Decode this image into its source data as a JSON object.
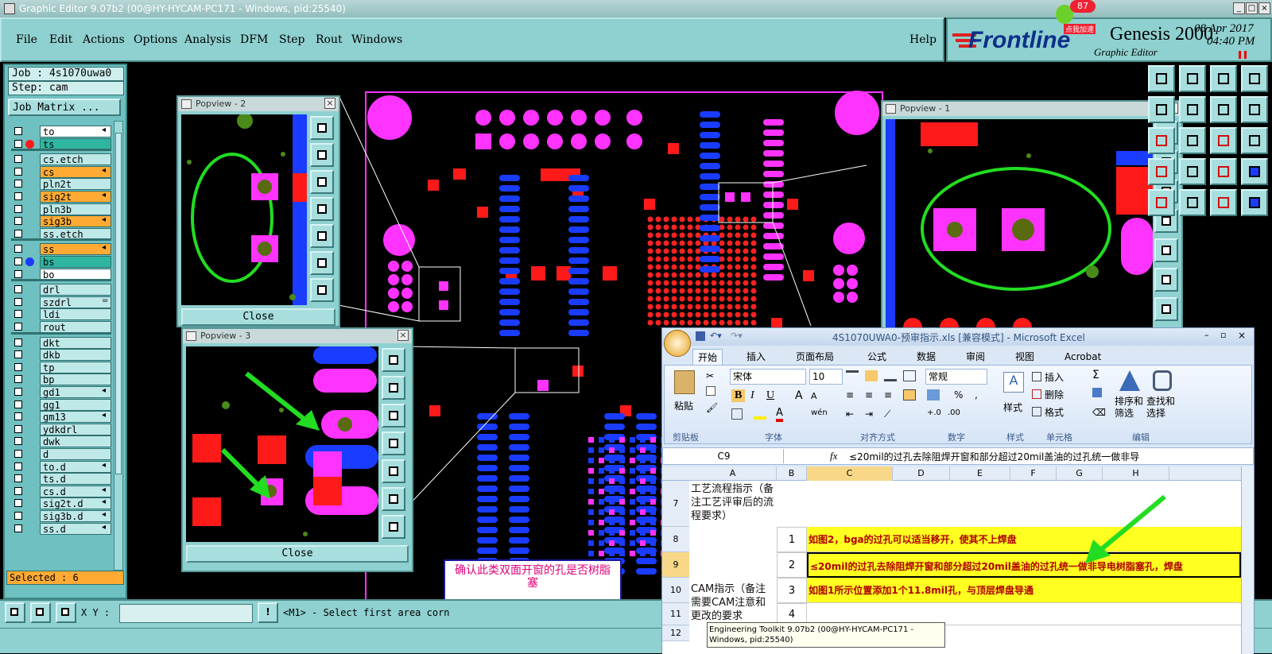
{
  "window": {
    "title": "Graphic Editor 9.07b2 (00@HY-HYCAM-PC171 - Windows, pid:25540)"
  },
  "menu": [
    "File",
    "Edit",
    "Actions",
    "Options",
    "Analysis",
    "DFM",
    "Step",
    "Rout",
    "Windows"
  ],
  "help": "Help",
  "brand": {
    "logo": "Frontline",
    "product": "Genesis 2000",
    "subtitle": "Graphic Editor",
    "date": "08 Apr 2017",
    "time": "04:40 PM",
    "badge": "87",
    "badge_caption": "点我加速"
  },
  "job": {
    "job_label": "Job : 4s1070uwa0",
    "step_label": "Step: cam",
    "matrix_button": "Job Matrix ..."
  },
  "layers": [
    {
      "name": "to",
      "color": "#ffffff",
      "dot": "",
      "arrow": "◂"
    },
    {
      "name": "ts",
      "color": "#2fb6a0",
      "dot": "#ff1a1a",
      "arrow": ""
    },
    {
      "name": "cs.etch",
      "color": "#bfe8e8",
      "dot": "",
      "arrow": ""
    },
    {
      "name": "cs",
      "color": "#ffaa33",
      "dot": "",
      "arrow": "◂"
    },
    {
      "name": "pln2t",
      "color": "#bfe8e8",
      "dot": "",
      "arrow": ""
    },
    {
      "name": "sig2t",
      "color": "#ffaa33",
      "dot": "",
      "arrow": "◂"
    },
    {
      "name": "pln3b",
      "color": "#bfe8e8",
      "dot": "",
      "arrow": ""
    },
    {
      "name": "sig3b",
      "color": "#ffaa33",
      "dot": "",
      "arrow": "◂"
    },
    {
      "name": "ss.etch",
      "color": "#bfe8e8",
      "dot": "",
      "arrow": ""
    },
    {
      "name": "ss",
      "color": "#ffaa33",
      "dot": "",
      "arrow": "◂"
    },
    {
      "name": "bs",
      "color": "#2fb6a0",
      "dot": "#1a3cff",
      "arrow": ""
    },
    {
      "name": "bo",
      "color": "#ffffff",
      "dot": "",
      "arrow": ""
    },
    {
      "name": "drl",
      "color": "#bfe8e8",
      "dot": "",
      "arrow": ""
    },
    {
      "name": "szdrl",
      "color": "#bfe8e8",
      "dot": "",
      "arrow": "="
    },
    {
      "name": "ldi",
      "color": "#bfe8e8",
      "dot": "",
      "arrow": ""
    },
    {
      "name": "rout",
      "color": "#bfe8e8",
      "dot": "",
      "arrow": ""
    },
    {
      "name": "dkt",
      "color": "#bfe8e8",
      "dot": "",
      "arrow": ""
    },
    {
      "name": "dkb",
      "color": "#bfe8e8",
      "dot": "",
      "arrow": ""
    },
    {
      "name": "tp",
      "color": "#bfe8e8",
      "dot": "",
      "arrow": ""
    },
    {
      "name": "bp",
      "color": "#bfe8e8",
      "dot": "",
      "arrow": ""
    },
    {
      "name": "gd1",
      "color": "#bfe8e8",
      "dot": "",
      "arrow": "◂"
    },
    {
      "name": "gg1",
      "color": "#bfe8e8",
      "dot": "",
      "arrow": ""
    },
    {
      "name": "gm13",
      "color": "#bfe8e8",
      "dot": "",
      "arrow": "◂"
    },
    {
      "name": "ydkdrl",
      "color": "#bfe8e8",
      "dot": "",
      "arrow": ""
    },
    {
      "name": "dwk",
      "color": "#bfe8e8",
      "dot": "",
      "arrow": ""
    },
    {
      "name": "d",
      "color": "#bfe8e8",
      "dot": "",
      "arrow": ""
    },
    {
      "name": "to.d",
      "color": "#bfe8e8",
      "dot": "",
      "arrow": "◂"
    },
    {
      "name": "ts.d",
      "color": "#bfe8e8",
      "dot": "",
      "arrow": ""
    },
    {
      "name": "cs.d",
      "color": "#bfe8e8",
      "dot": "",
      "arrow": "◂"
    },
    {
      "name": "sig2t.d",
      "color": "#bfe8e8",
      "dot": "",
      "arrow": "◂"
    },
    {
      "name": "sig3b.d",
      "color": "#bfe8e8",
      "dot": "",
      "arrow": "◂"
    },
    {
      "name": "ss.d",
      "color": "#bfe8e8",
      "dot": "",
      "arrow": "◂"
    }
  ],
  "selected": "Selected : 6",
  "status": {
    "xy_label": "X Y :",
    "message": "<M1> - Select first area corn",
    "tooltip": "Engineering Toolkit 9.07b2 (00@HY-HYCAM-PC171 - Windows, pid:25540)"
  },
  "popups": {
    "p1": "Popview - 1",
    "p2": "Popview - 2",
    "p3": "Popview - 3",
    "close": "Close"
  },
  "note": "确认此类双面开窗的孔是否树脂塞",
  "excel": {
    "title": "4S1070UWA0-预审指示.xls  [兼容模式] - Microsoft Excel",
    "tabs": [
      "开始",
      "插入",
      "页面布局",
      "公式",
      "数据",
      "审阅",
      "视图",
      "Acrobat"
    ],
    "font": "宋体",
    "size": "10",
    "number_format": "常规",
    "groups": [
      "剪贴板",
      "字体",
      "对齐方式",
      "数字",
      "样式",
      "单元格",
      "编辑"
    ],
    "paste": "粘贴",
    "style_btn": "样式",
    "insert": "插入",
    "delete": "删除",
    "format": "格式",
    "sort": "排序和筛选",
    "find": "查找和选择",
    "cellref": "C9",
    "fx": "fx",
    "formula": "≤20mil的过孔去除阻焊开窗和部分超过20mil盖油的过孔统一做非导",
    "cols": [
      "A",
      "B",
      "C",
      "D",
      "E",
      "F",
      "G",
      "H"
    ],
    "rows": [
      {
        "n": "7",
        "a": "工艺流程指示（备注工艺评审后的流程要求）",
        "b": "",
        "c": ""
      },
      {
        "n": "8",
        "a": "",
        "b": "1",
        "c": "如图2，bga的过孔可以适当移开，使其不上焊盘"
      },
      {
        "n": "9",
        "a": "",
        "b": "2",
        "c": "≤20mil的过孔去除阻焊开窗和部分超过20mil盖油的过孔统一做非导电树脂塞孔，焊盘"
      },
      {
        "n": "10",
        "a": "CAM指示（备注需要CAM注意和更改的要求",
        "b": "3",
        "c": "如图1所示位置添加1个11.8mil孔，与顶层焊盘导通"
      },
      {
        "n": "11",
        "a": "",
        "b": "4",
        "c": ""
      },
      {
        "n": "12",
        "a": "",
        "b": "",
        "c": ""
      }
    ]
  }
}
